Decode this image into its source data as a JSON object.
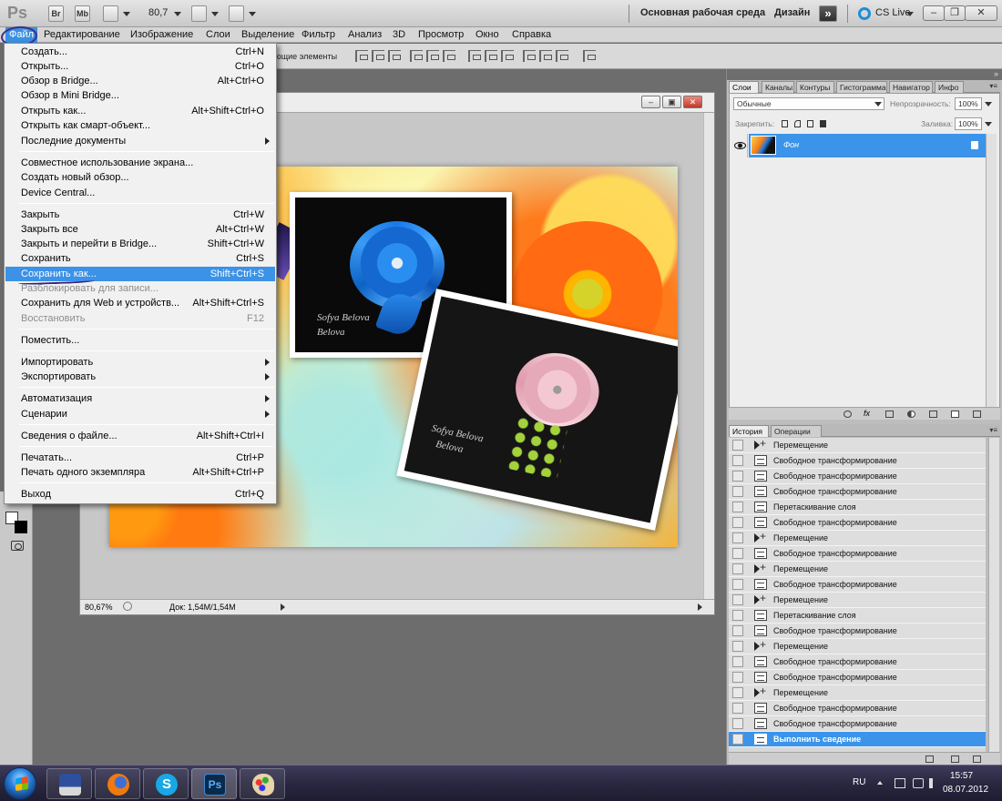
{
  "appbar": {
    "logo": "Ps",
    "bridge_btn": "Br",
    "minibridge_btn": "Mb",
    "zoom": "80,7",
    "workspace": "Основная рабочая среда",
    "design": "Дизайн",
    "cslive": "CS Live"
  },
  "menubar": {
    "items": [
      "Файл",
      "Редактирование",
      "Изображение",
      "Слои",
      "Выделение",
      "Фильтр",
      "Анализ",
      "3D",
      "Просмотр",
      "Окно",
      "Справка"
    ]
  },
  "options_bar": {
    "text": "ющие элементы"
  },
  "file_menu": {
    "items": [
      {
        "label": "Создать...",
        "shortcut": "Ctrl+N"
      },
      {
        "label": "Открыть...",
        "shortcut": "Ctrl+O"
      },
      {
        "label": "Обзор в Bridge...",
        "shortcut": "Alt+Ctrl+O"
      },
      {
        "label": "Обзор в Mini Bridge...",
        "shortcut": ""
      },
      {
        "label": "Открыть как...",
        "shortcut": "Alt+Shift+Ctrl+O"
      },
      {
        "label": "Открыть как смарт-объект...",
        "shortcut": ""
      },
      {
        "label": "Последние документы",
        "shortcut": ""
      },
      {
        "label": "Совместное использование экрана...",
        "shortcut": ""
      },
      {
        "label": "Создать новый обзор...",
        "shortcut": ""
      },
      {
        "label": "Device Central...",
        "shortcut": ""
      },
      {
        "label": "Закрыть",
        "shortcut": "Ctrl+W"
      },
      {
        "label": "Закрыть все",
        "shortcut": "Alt+Ctrl+W"
      },
      {
        "label": "Закрыть и перейти в Bridge...",
        "shortcut": "Shift+Ctrl+W"
      },
      {
        "label": "Сохранить",
        "shortcut": "Ctrl+S"
      },
      {
        "label": "Сохранить как...",
        "shortcut": "Shift+Ctrl+S"
      },
      {
        "label": "Разблокировать для записи...",
        "shortcut": ""
      },
      {
        "label": "Сохранить для Web и устройств...",
        "shortcut": "Alt+Shift+Ctrl+S"
      },
      {
        "label": "Восстановить",
        "shortcut": "F12"
      },
      {
        "label": "Поместить...",
        "shortcut": ""
      },
      {
        "label": "Импортировать",
        "shortcut": ""
      },
      {
        "label": "Экспортировать",
        "shortcut": ""
      },
      {
        "label": "Автоматизация",
        "shortcut": ""
      },
      {
        "label": "Сценарии",
        "shortcut": ""
      },
      {
        "label": "Сведения о файле...",
        "shortcut": "Alt+Shift+Ctrl+I"
      },
      {
        "label": "Печатать...",
        "shortcut": "Ctrl+P"
      },
      {
        "label": "Печать одного экземпляра",
        "shortcut": "Alt+Shift+Ctrl+P"
      },
      {
        "label": "Выход",
        "shortcut": "Ctrl+Q"
      }
    ]
  },
  "document": {
    "zoom": "80,67%",
    "doc_info": "Док: 1,54M/1,54M",
    "watermark1": "Sofya Belova",
    "watermark2": "Belova"
  },
  "layers_panel": {
    "tabs": [
      "Слои",
      "Каналы",
      "Контуры",
      "Гистограмма",
      "Навигатор",
      "Инфо"
    ],
    "blend_mode": "Обычные",
    "opacity_label": "Непрозрачность:",
    "opacity_value": "100%",
    "lock_label": "Закрепить:",
    "fill_label": "Заливка:",
    "fill_value": "100%",
    "layer_name": "Фон"
  },
  "history_panel": {
    "tabs": [
      "История",
      "Операции"
    ],
    "items": [
      "Перемещение",
      "Свободное трансформирование",
      "Свободное трансформирование",
      "Свободное трансформирование",
      "Перетаскивание слоя",
      "Свободное трансформирование",
      "Перемещение",
      "Свободное трансформирование",
      "Перемещение",
      "Свободное трансформирование",
      "Перемещение",
      "Перетаскивание слоя",
      "Свободное трансформирование",
      "Перемещение",
      "Свободное трансформирование",
      "Свободное трансформирование",
      "Перемещение",
      "Свободное трансформирование",
      "Свободное трансформирование",
      "Выполнить сведение"
    ]
  },
  "taskbar": {
    "lang": "RU",
    "time": "15:57",
    "date": "08.07.2012",
    "ps_label": "Ps"
  }
}
